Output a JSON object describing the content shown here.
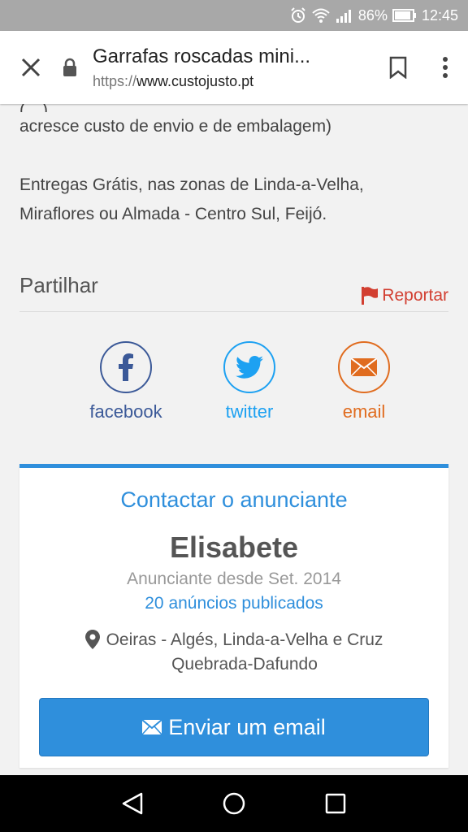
{
  "status_bar": {
    "battery_percent": "86%",
    "time": "12:45"
  },
  "browser": {
    "page_title": "Garrafas roscadas mini...",
    "url_prefix": "https://",
    "url_domain": "www.custojusto.pt"
  },
  "description": {
    "partial_line": "(…) …",
    "line1": "acresce custo de envio e de embalagem)",
    "line2": "Entregas Grátis, nas zonas de Linda-a-Velha,",
    "line3": "Miraflores ou Almada - Centro Sul, Feijó."
  },
  "share": {
    "title": "Partilhar",
    "report_label": "Reportar",
    "facebook_label": "facebook",
    "twitter_label": "twitter",
    "email_label": "email"
  },
  "contact": {
    "title": "Contactar o anunciante",
    "seller_name": "Elisabete",
    "since": "Anunciante desde Set. 2014",
    "ads_count": "20 anúncios publicados",
    "location_line1": "Oeiras - Algés, Linda-a-Velha e Cruz",
    "location_line2": "Quebrada-Dafundo",
    "email_button": "Enviar um email"
  },
  "colors": {
    "accent": "#2f8fdc",
    "report": "#d23f31",
    "facebook": "#3b5998",
    "twitter": "#1da1f2",
    "email": "#e06c1f"
  }
}
